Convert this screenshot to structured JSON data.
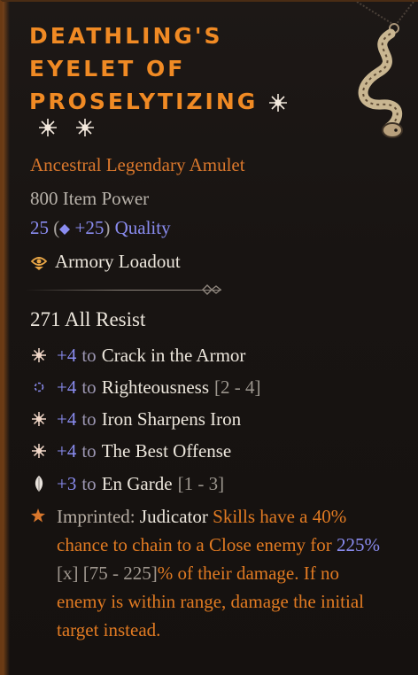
{
  "item": {
    "title_lines": [
      "DEATHLING'S",
      "EYELET OF",
      "PROSELYTIZING"
    ],
    "type": "Ancestral Legendary Amulet",
    "item_power": "800 Item Power",
    "quality_base": "25",
    "quality_bonus": "+25",
    "quality_label": "Quality",
    "loadout": "Armory Loadout",
    "all_resist": "271 All Resist"
  },
  "affixes": [
    {
      "icon": "spark-icon",
      "plus": "+4",
      "to": "to",
      "name": "Crack in the Armor",
      "range": ""
    },
    {
      "icon": "ring-icon",
      "plus": "+4",
      "to": "to",
      "name": "Righteousness",
      "range": "[2 - 4]"
    },
    {
      "icon": "spark-icon",
      "plus": "+4",
      "to": "to",
      "name": "Iron Sharpens Iron",
      "range": ""
    },
    {
      "icon": "spark-icon",
      "plus": "+4",
      "to": "to",
      "name": "The Best Offense",
      "range": ""
    },
    {
      "icon": "feather-icon",
      "plus": "+3",
      "to": "to",
      "name": "En Garde",
      "range": "[1 - 3]"
    }
  ],
  "imprinted": {
    "label": "Imprinted:",
    "class_name": "Judicator",
    "text_a": "Skills have a 40% chance to chain to a Close enemy for",
    "value": "225%",
    "text_b": "[x] [75 - 225]",
    "text_c": "% of their damage. If no enemy is within range, damage the initial target instead."
  },
  "colors": {
    "title": "#f08a24",
    "legendary": "#d9772c",
    "blue_value": "#8a8cf0",
    "text": "#ece6dc"
  }
}
